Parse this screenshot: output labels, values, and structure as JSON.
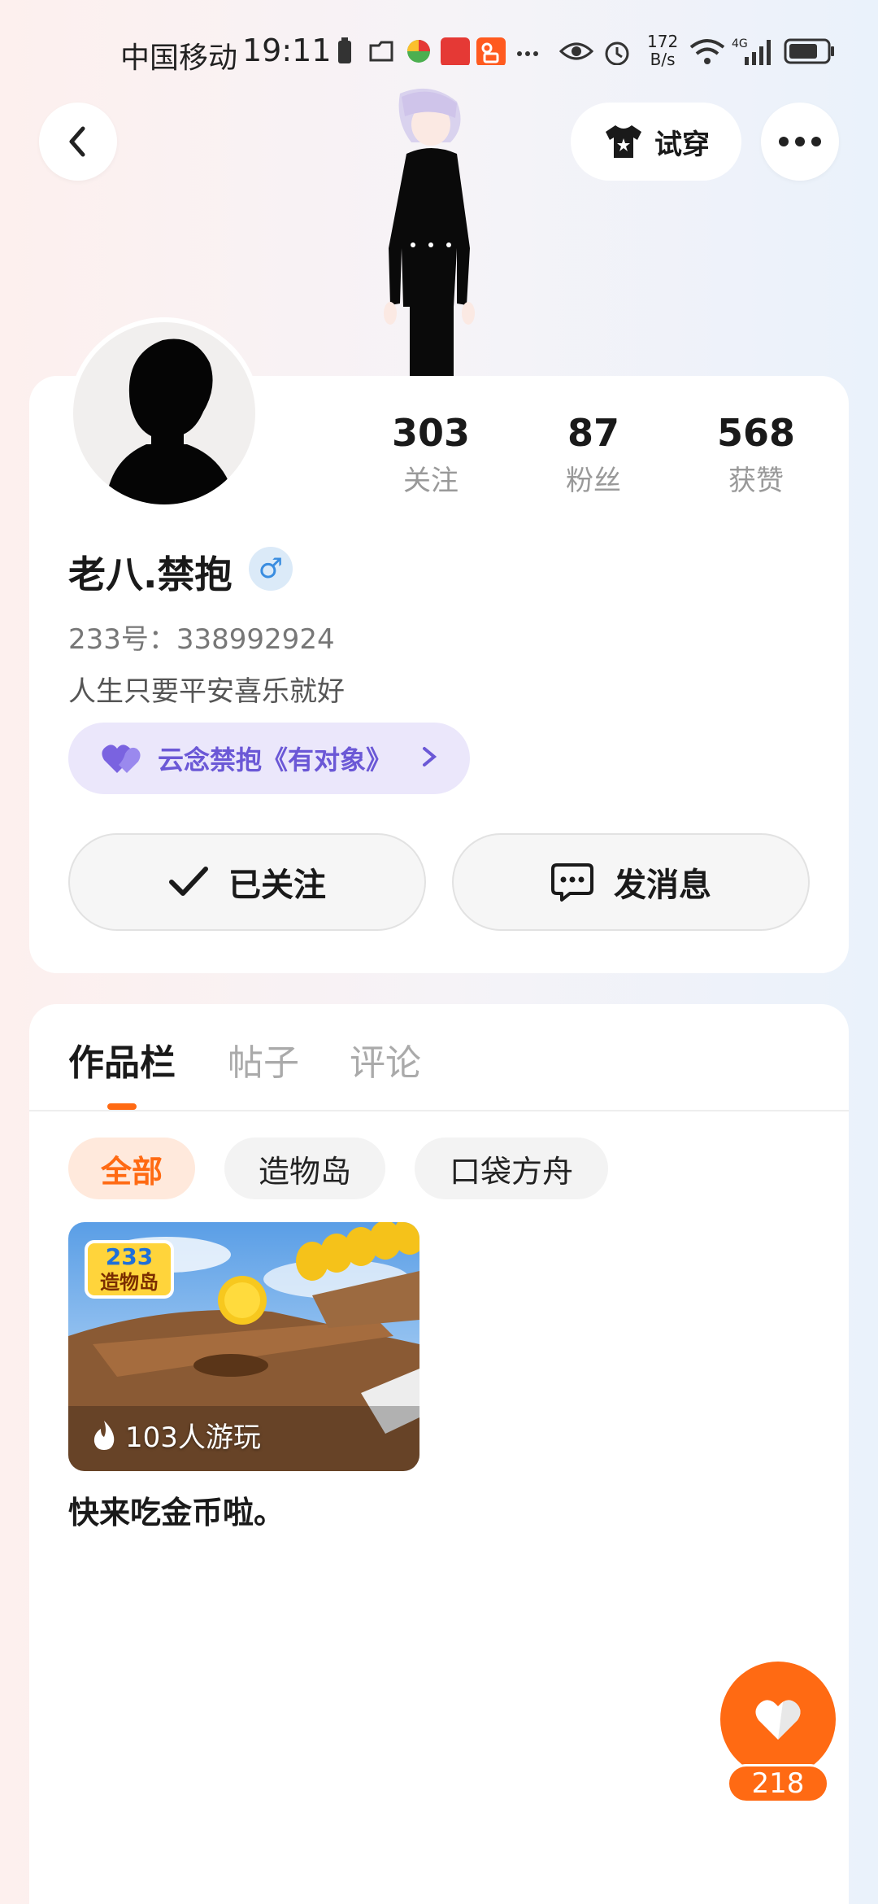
{
  "status_bar": {
    "carrier": "中国移动",
    "time": "19:11",
    "net_speed_top": "172",
    "net_speed_bottom": "B/s",
    "network": "4G"
  },
  "header": {
    "try_on_label": "试穿"
  },
  "profile": {
    "stats": [
      {
        "value": "303",
        "label": "关注"
      },
      {
        "value": "87",
        "label": "粉丝"
      },
      {
        "value": "568",
        "label": "获赞"
      }
    ],
    "username": "老八.禁抱",
    "gender_symbol": "♂",
    "user_id": "233号：338992924",
    "bio": "人生只要平安喜乐就好",
    "memorial_text": "云念禁抱《有对象》",
    "follow_button": "已关注",
    "message_button": "发消息"
  },
  "works": {
    "tabs": [
      "作品栏",
      "帖子",
      "评论"
    ],
    "filters": [
      "全部",
      "造物岛",
      "口袋方舟"
    ],
    "items": [
      {
        "logo_top": "233",
        "logo_bottom": "造物岛",
        "players": "103人游玩",
        "title": "快来吃金币啦。"
      }
    ]
  },
  "like": {
    "count": "218"
  },
  "colors": {
    "accent": "#ff6a13",
    "memorial_bg": "#ebe7fb",
    "memorial_text": "#6b58d6",
    "gender_blue": "#3a8de0"
  }
}
